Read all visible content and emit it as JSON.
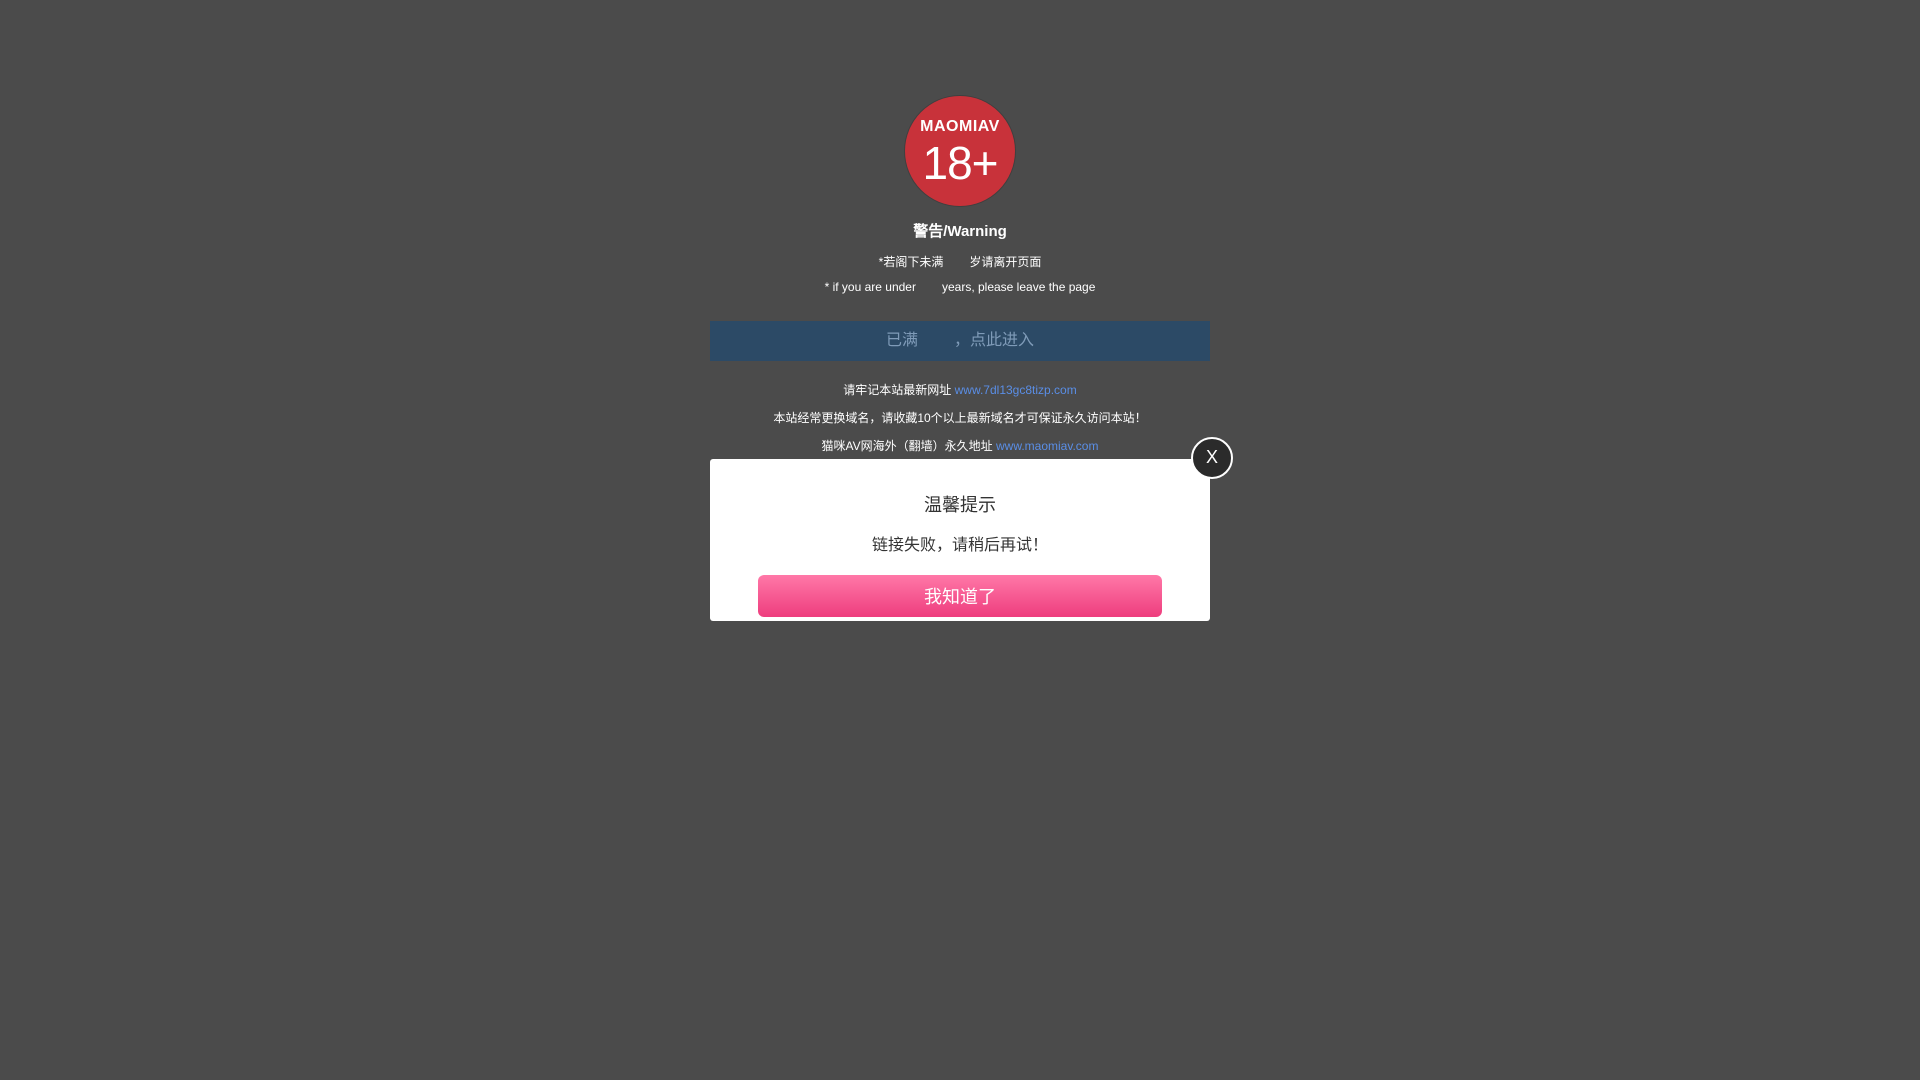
{
  "logo": {
    "brand": "MAOMIAV",
    "age": "18+"
  },
  "warning": {
    "title": "警告/Warning",
    "zh_part1": "*若阁下未满",
    "zh_part2": "岁请离开页面",
    "en_part1": "* if you are under",
    "en_part2": "years, please leave the page"
  },
  "enter": {
    "part1": "已满",
    "part2": "，点此进入"
  },
  "sites": {
    "line1_text": "请牢记本站最新网址",
    "line1_link": "www.7dl13gc8tizp.com",
    "line2_text": "本站经常更换域名，请收藏10个以上最新域名才可保证永久访问本站！",
    "line3_text": "猫咪AV网海外（翻墙）永久地址",
    "line3_link": "www.maomiav.com"
  },
  "modal": {
    "title": "温馨提示",
    "message": "链接失败，请稍后再试！",
    "button": "我知道了",
    "close": "X"
  },
  "colors": {
    "background": "#4b4b4b",
    "logo_red": "#c8323a",
    "enter_bar": "#2c4a66",
    "link": "#5a8ee6",
    "button_pink": "#f0548c"
  }
}
